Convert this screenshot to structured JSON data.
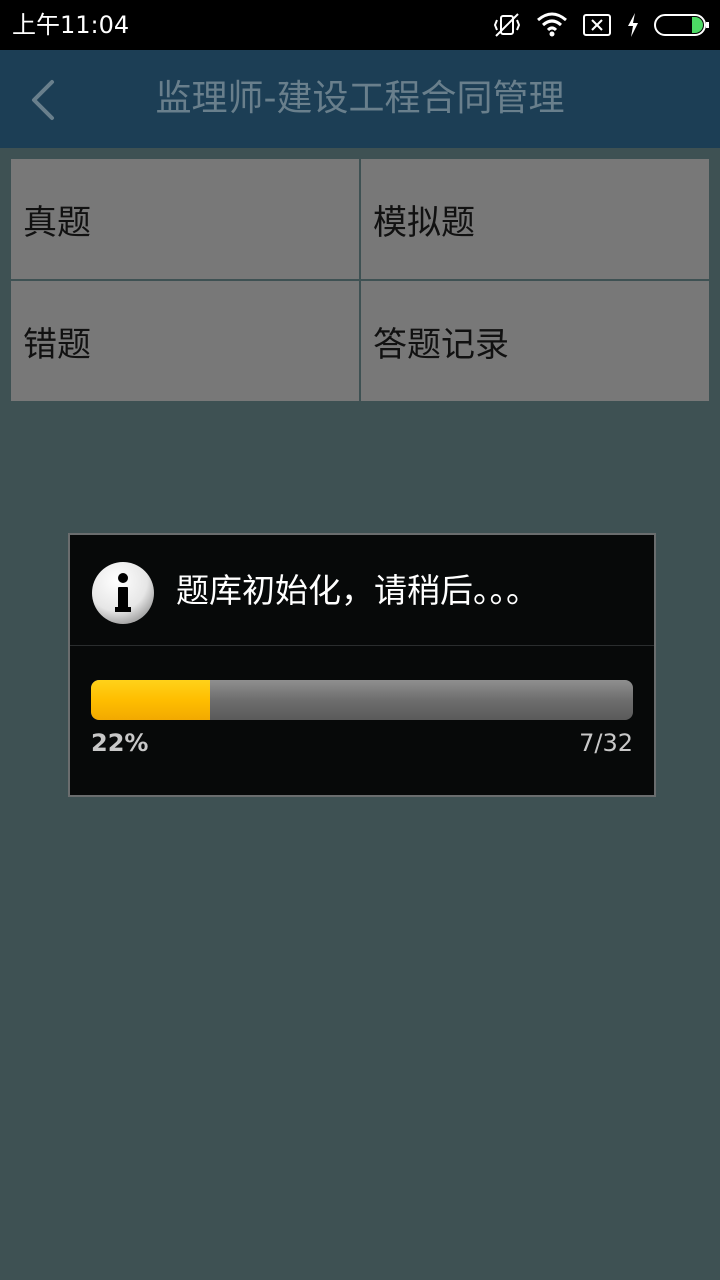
{
  "status_bar": {
    "time": "上午11:04",
    "icons": [
      "vibrate-off-icon",
      "wifi-icon",
      "sim-x-icon",
      "charging-icon",
      "battery-icon"
    ],
    "battery_color": "#4cd964"
  },
  "app_bar": {
    "title": "监理师-建设工程合同管理",
    "back_icon": "chevron-left-icon",
    "background": "#1c3e55"
  },
  "menu": {
    "items": [
      {
        "label": "真题"
      },
      {
        "label": "模拟题"
      },
      {
        "label": "错题"
      },
      {
        "label": "答题记录"
      }
    ]
  },
  "dialog": {
    "icon": "info-icon",
    "message": "题库初始化，请稍后。。。",
    "progress": {
      "fraction": 0.22,
      "percent_label": "22%",
      "count_label": "7/32"
    },
    "accent": "#ffbe00"
  }
}
